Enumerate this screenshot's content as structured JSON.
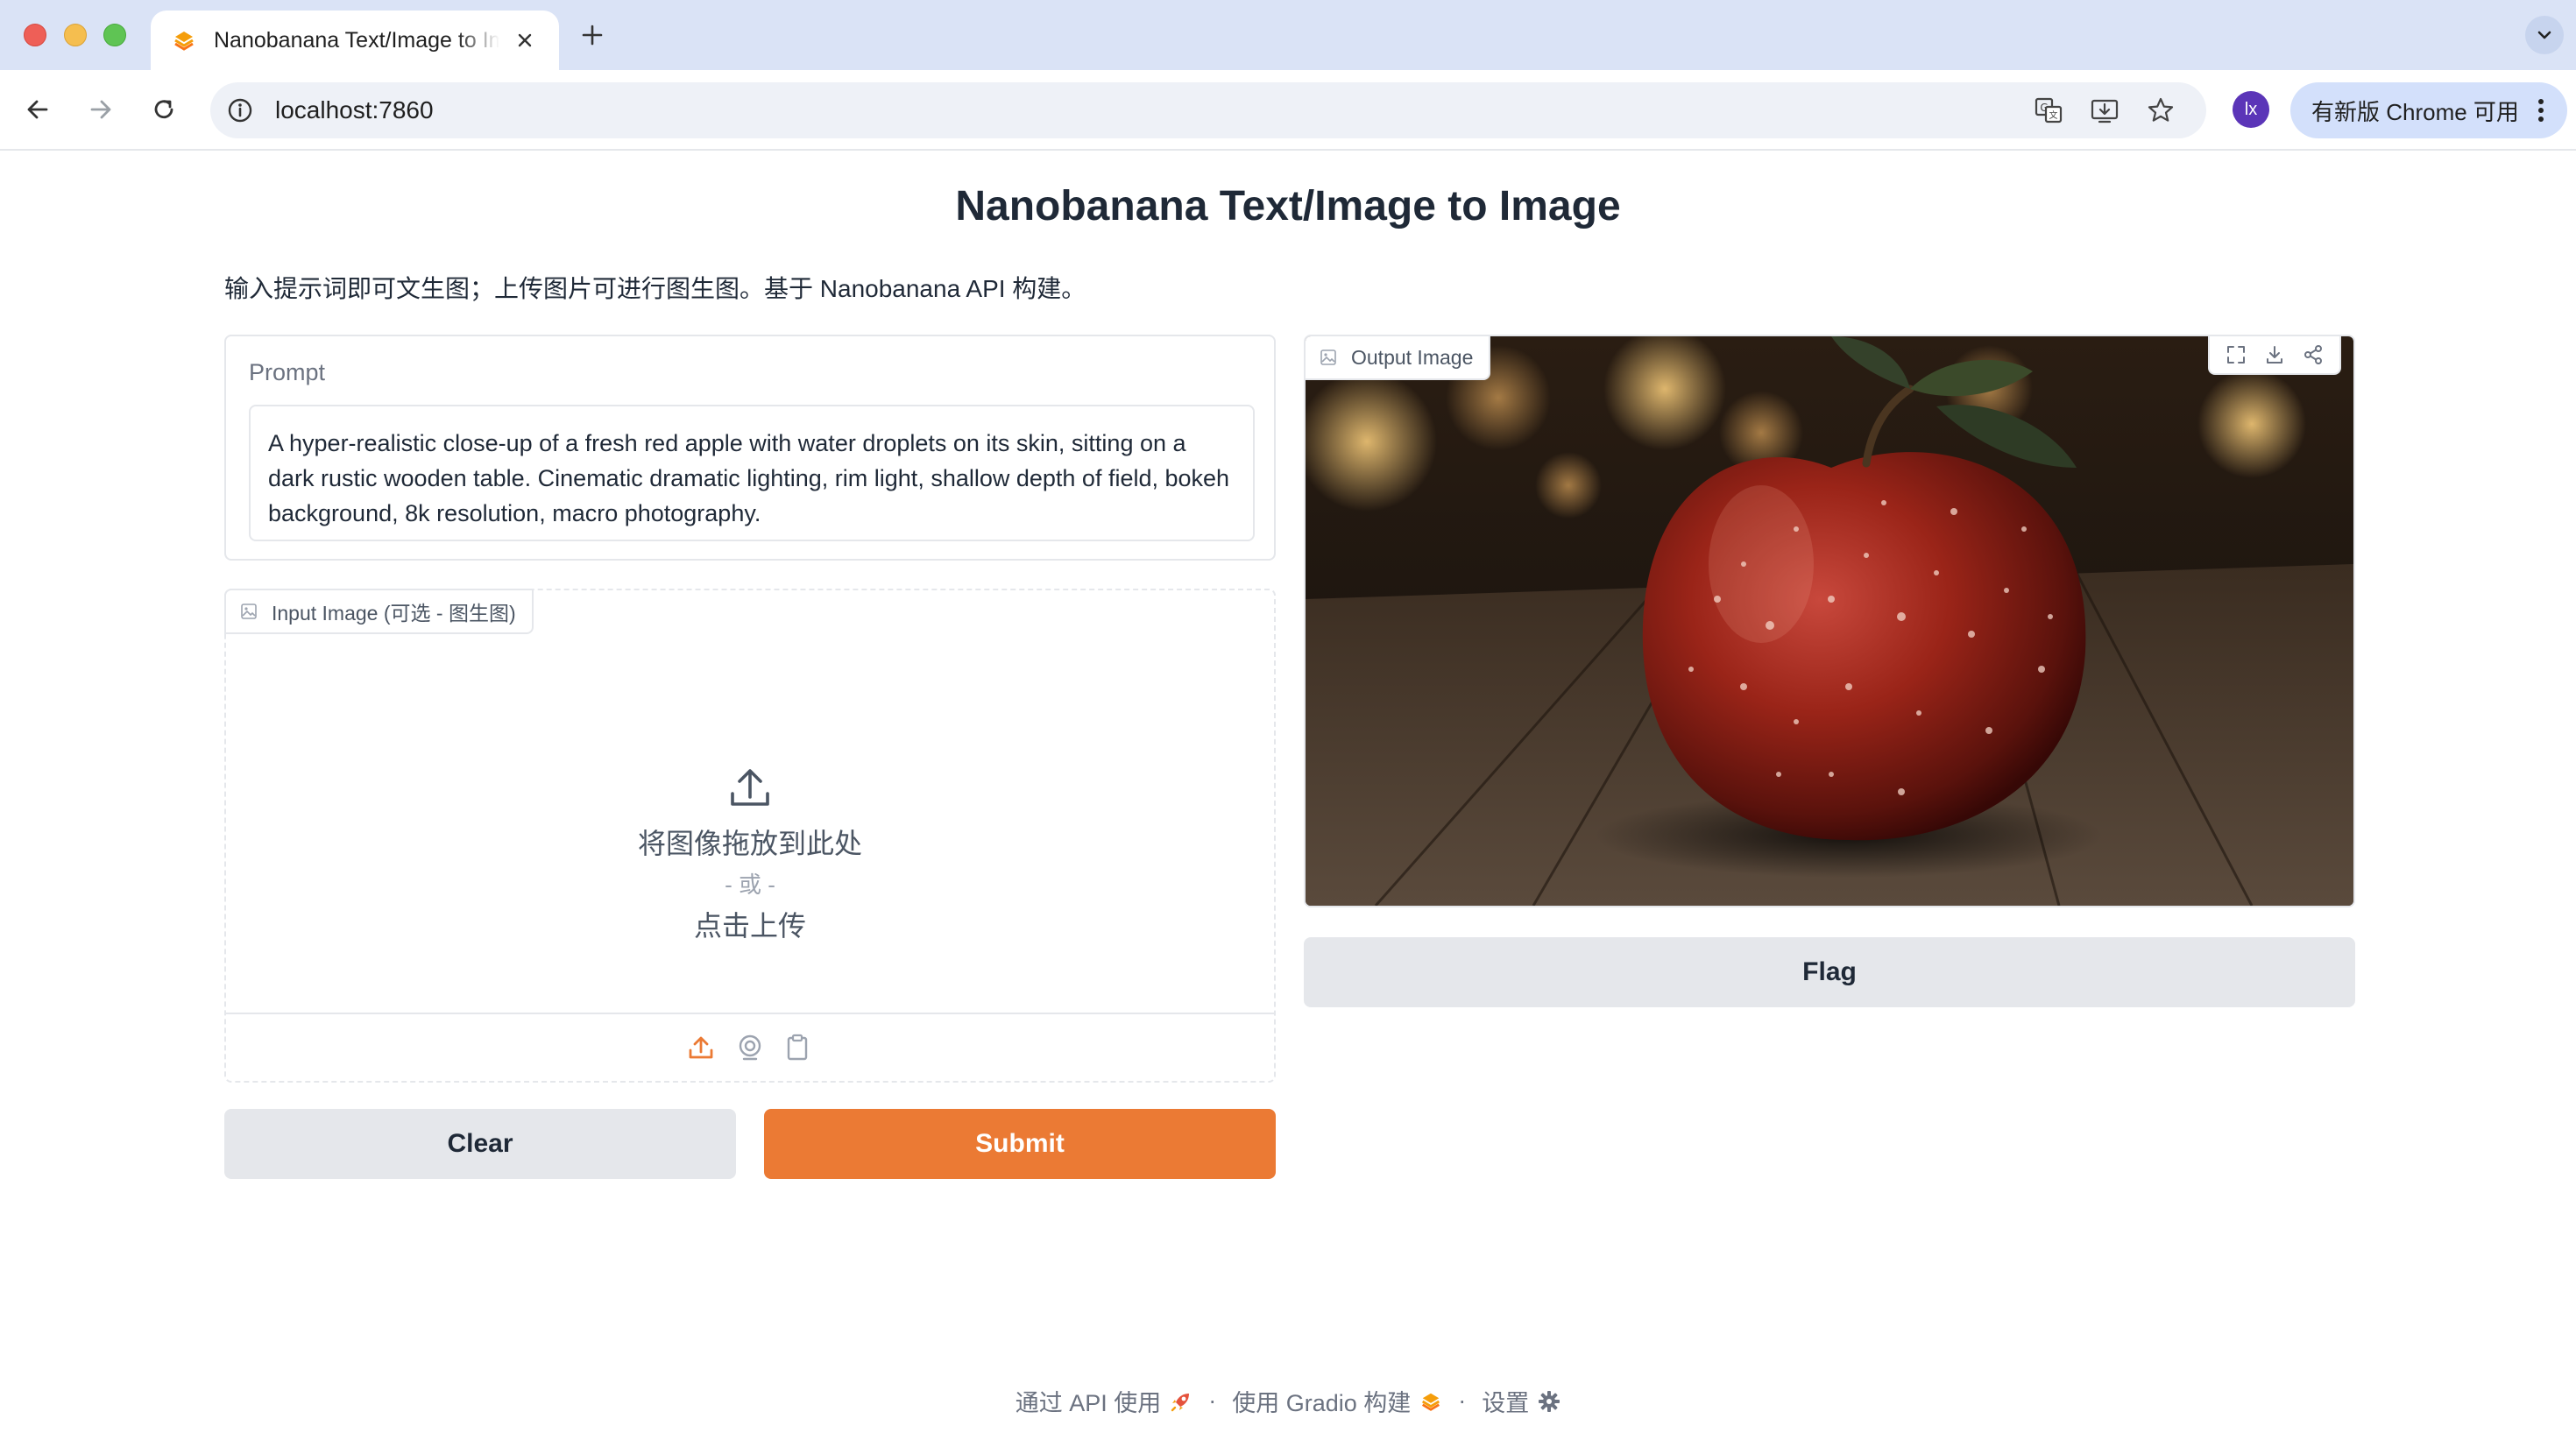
{
  "browser": {
    "tab_title": "Nanobanana Text/Image to Image",
    "url": "localhost:7860",
    "profile_initials": "lx",
    "update_label": "有新版 Chrome 可用"
  },
  "page": {
    "title": "Nanobanana Text/Image to Image",
    "description": "输入提示词即可文生图；上传图片可进行图生图。基于 Nanobanana API 构建。"
  },
  "prompt": {
    "label": "Prompt",
    "value": "A hyper-realistic close-up of a fresh red apple with water droplets on its skin, sitting on a dark rustic wooden table. Cinematic dramatic lighting, rim light, shallow depth of field, bokeh background, 8k resolution, macro photography."
  },
  "input_image": {
    "label": "Input Image (可选 - 图生图)",
    "drop_text": "将图像拖放到此处",
    "or_text": "- 或 -",
    "click_text": "点击上传"
  },
  "output_image": {
    "label": "Output Image"
  },
  "buttons": {
    "clear": "Clear",
    "submit": "Submit",
    "flag": "Flag"
  },
  "footer": {
    "api": "通过 API 使用",
    "gradio": "使用 Gradio 构建",
    "settings": "设置",
    "separator": "·"
  },
  "colors": {
    "accent": "#eb7a34",
    "secondary_button": "#e5e7eb",
    "tabbar": "#dae3f6"
  }
}
